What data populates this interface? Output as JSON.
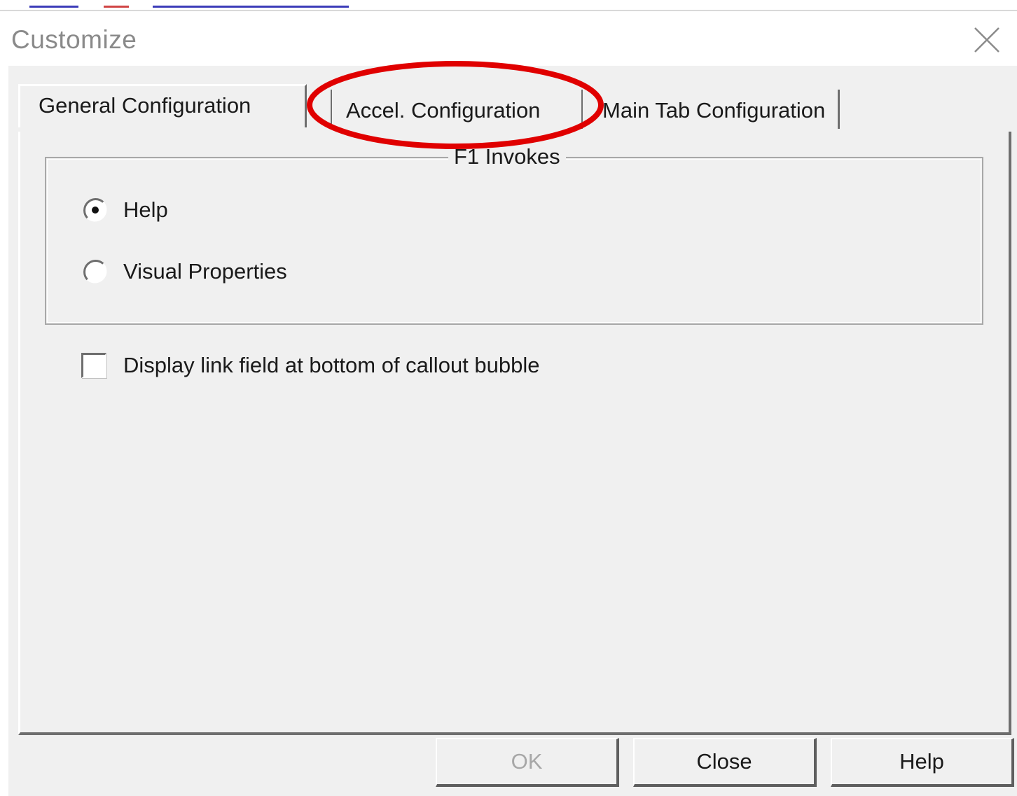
{
  "dialog": {
    "title": "Customize"
  },
  "tabs": [
    {
      "label": "General Configuration",
      "selected": true
    },
    {
      "label": "Accel. Configuration",
      "selected": false
    },
    {
      "label": "Main Tab Configuration",
      "selected": false
    }
  ],
  "f1_group": {
    "legend": "F1 Invokes",
    "options": [
      {
        "label": "Help",
        "checked": true
      },
      {
        "label": "Visual Properties",
        "checked": false
      }
    ]
  },
  "display_link": {
    "label": "Display link field at bottom of callout bubble",
    "checked": false
  },
  "buttons": {
    "ok": "OK",
    "close": "Close",
    "help": "Help"
  },
  "ok_enabled": false,
  "colors": {
    "annotation": "#e00000",
    "panel": "#f0f0f0",
    "disabled_text": "#a7a7a7"
  },
  "icons": {
    "close": "close-icon",
    "annotation": "red-highlight-ellipse"
  }
}
